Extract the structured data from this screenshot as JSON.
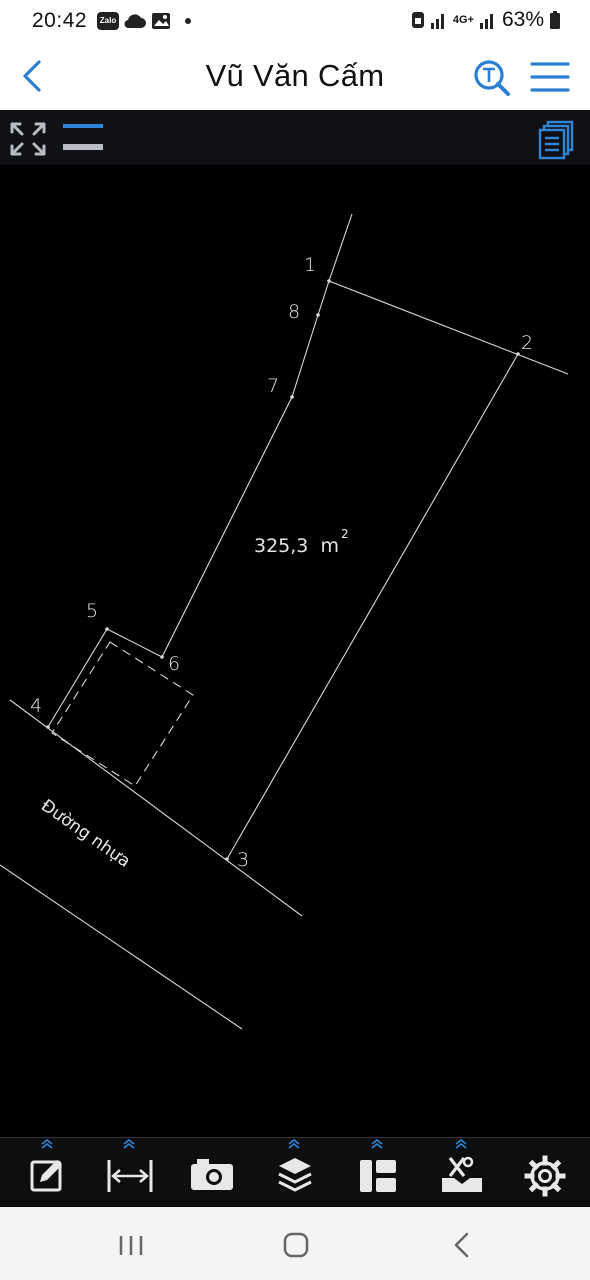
{
  "status": {
    "time": "20:42",
    "app_badge": "Zalo",
    "network": "4G+",
    "battery": "63%"
  },
  "header": {
    "title": "Vũ Văn Cấm"
  },
  "drawing": {
    "area_value": "325,3  m",
    "area_unit_superscript": "2",
    "road_label": "Đường nhựa",
    "point_labels": [
      "1",
      "2",
      "3",
      "4",
      "5",
      "6",
      "7",
      "8"
    ],
    "line_color": "#d8d8d8",
    "background": "#000000"
  },
  "toolbar": {
    "tools": [
      "edit-tool",
      "measure-tool",
      "camera-tool",
      "layers-tool",
      "layout-tool",
      "survey-tool",
      "settings-tool"
    ],
    "accent": "#2f86d8"
  },
  "colors": {
    "accent": "#2a7fd4",
    "header_bg": "#ffffff",
    "toolbar_bg": "#0d0e10"
  }
}
